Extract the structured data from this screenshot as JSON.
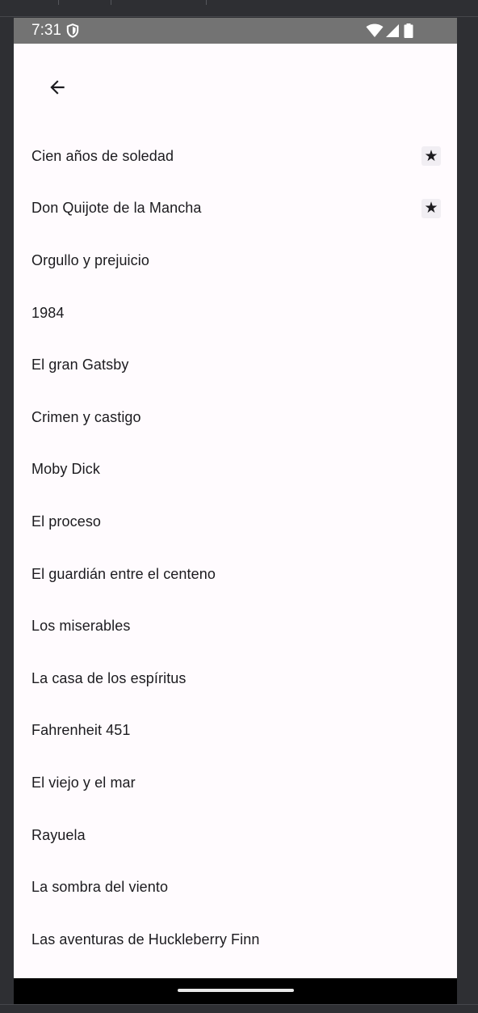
{
  "status_bar": {
    "time": "7:31",
    "icons": [
      "shield-icon",
      "wifi-icon",
      "signal-icon",
      "battery-icon"
    ]
  },
  "toolbar": {
    "back_icon": "arrow-back-icon"
  },
  "books": [
    {
      "title": "Cien años de soledad",
      "favorite": true
    },
    {
      "title": "Don Quijote de la Mancha",
      "favorite": true
    },
    {
      "title": "Orgullo y prejuicio",
      "favorite": false
    },
    {
      "title": "1984",
      "favorite": false
    },
    {
      "title": "El gran Gatsby",
      "favorite": false
    },
    {
      "title": "Crimen y castigo",
      "favorite": false
    },
    {
      "title": "Moby Dick",
      "favorite": false
    },
    {
      "title": "El proceso",
      "favorite": false
    },
    {
      "title": "El guardián entre el centeno",
      "favorite": false
    },
    {
      "title": "Los miserables",
      "favorite": false
    },
    {
      "title": "La casa de los espíritus",
      "favorite": false
    },
    {
      "title": "Fahrenheit 451",
      "favorite": false
    },
    {
      "title": "El viejo y el mar",
      "favorite": false
    },
    {
      "title": "Rayuela",
      "favorite": false
    },
    {
      "title": "La sombra del viento",
      "favorite": false
    },
    {
      "title": "Las aventuras de Huckleberry Finn",
      "favorite": false
    }
  ],
  "favorite_glyph": "★",
  "colors": {
    "status_bar": "#737373",
    "background": "#fffbfe",
    "text": "#1c1b1f",
    "nav_bar": "#000000"
  }
}
